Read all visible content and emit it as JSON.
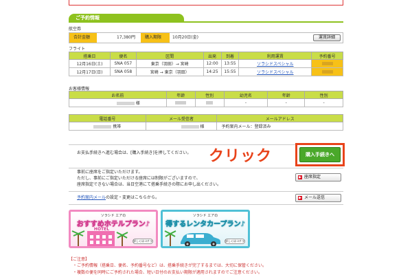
{
  "reservation": {
    "section_title": "ご予約情報",
    "ticket_label": "航空券",
    "total_label": "合計金額",
    "total_value": "17,380円",
    "deadline_label": "購入期限",
    "deadline_value": "10月20日(金)",
    "fare_detail_button": "運賃詳細"
  },
  "flight": {
    "label": "フライト",
    "headers": [
      "搭乗日",
      "便名",
      "区間",
      "出発",
      "到着",
      "利用運賃",
      "予約番号"
    ],
    "rows": [
      [
        "12月16日(土)",
        "SNA 057",
        "東京（羽田）→ 宮崎",
        "12:00",
        "13:55",
        "ソラシドスペシャル",
        ""
      ],
      [
        "12月17日(日)",
        "SNA 058",
        "宮崎 → 東京（羽田）",
        "14:25",
        "15:55",
        "ソラシドスペシャル",
        ""
      ]
    ]
  },
  "customer": {
    "label": "お客様情報",
    "headers": [
      "お名前",
      "年齢",
      "性別",
      "幼児名",
      "年齢",
      "性別"
    ],
    "row": [
      "様",
      "",
      "",
      "-",
      "-",
      "-"
    ],
    "contact_headers": [
      "電話番号",
      "メール受信者",
      "メールアドレス"
    ],
    "contact_row": [
      "携帯",
      "様",
      "予約案内メール：登録済み"
    ]
  },
  "instructions": {
    "purchase_text": "お支払手続きへ進む場合は、[購入手続き]を押してください。",
    "click_label": "クリック",
    "purchase_button": "購入手続きへ",
    "seat_text_1": "事前に座席をご指定いただけます。",
    "seat_text_2": "ただし、事前にご指定いただける座席には制限がございますので、",
    "seat_text_3": "座席指定できない場合は、当日空港にて搭乗手続きの際にお申し出ください。",
    "seat_button": "座席指定",
    "mail_link": "予約案内メール",
    "mail_text": "の設定・変更はこちらから。",
    "mail_button": "メール送信"
  },
  "banners": {
    "hotel_small": "ソラシド エアの",
    "hotel_title": "おすすめホテルプラン♪",
    "hotel_word": "HOTEL",
    "hotel_detail": "詳しくはコチラ",
    "car_small": "ソラシド エアの",
    "car_title": "得するレンタカープラン♪",
    "car_detail": "詳しくはコチラ"
  },
  "notes": {
    "heading": "【ご注意】",
    "items": [
      "・ご予約情報（搭乗日、便名、予約番号など）は、搭乗手続きが完了するまでは、大切に保管ください。",
      "・複数の便を同時にご予約された場合、短い日付のお支払い期限が適用されますのでご注意ください。"
    ]
  },
  "colors": {
    "accent_green": "#8ec21f",
    "header_yellowgreen": "#c9dd48",
    "highlight_yellow": "#f7c117",
    "callout_red": "#e8431a",
    "buy_green": "#4aa82a"
  }
}
